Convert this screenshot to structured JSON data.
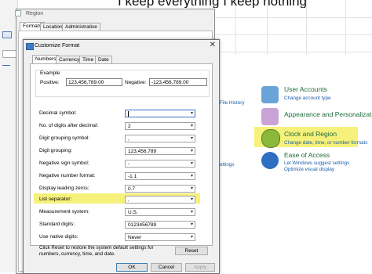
{
  "banner": {
    "text": "I keep everything I keep nothing"
  },
  "region": {
    "title": "Region",
    "tabs": [
      "Formats",
      "Location",
      "Administrative"
    ]
  },
  "customize": {
    "title": "Customize Format",
    "close": "✕",
    "tabs": [
      "Numbers",
      "Currency",
      "Time",
      "Date"
    ],
    "example": {
      "label": "Example",
      "positive_label": "Positive:",
      "positive_value": "123,456,789.00",
      "negative_label": "Negative:",
      "negative_value": "-123,456,789.00"
    },
    "rows": [
      {
        "label": "Decimal symbol:",
        "value": ""
      },
      {
        "label": "No. of digits after decimal:",
        "value": "2"
      },
      {
        "label": "Digit grouping symbol:",
        "value": ","
      },
      {
        "label": "Digit grouping:",
        "value": "123,456,789"
      },
      {
        "label": "Negative sign symbol:",
        "value": "-"
      },
      {
        "label": "Negative number format:",
        "value": "-1.1"
      },
      {
        "label": "Display leading zeros:",
        "value": "0.7"
      },
      {
        "label": "List separator:",
        "value": ","
      },
      {
        "label": "Measurement system:",
        "value": "U.S."
      },
      {
        "label": "Standard digits:",
        "value": "0123456789"
      },
      {
        "label": "Use native digits:",
        "value": "Never"
      }
    ],
    "reset_text": "Click Reset to restore the system default settings for numbers, currency, time, and date.",
    "reset_button": "Reset",
    "ok_button": "OK",
    "cancel_button": "Cancel",
    "apply_button": "Apply"
  },
  "control_panel": {
    "user_accounts": {
      "title": "User Accounts",
      "link": "Change account type"
    },
    "appearance": {
      "title": "Appearance and Personalization"
    },
    "clock": {
      "title": "Clock and Region",
      "link": "Change date, time, or number formats"
    },
    "ease": {
      "title": "Ease of Access",
      "link1": "Let Windows suggest settings",
      "link2": "Optimize visual display"
    },
    "file_history": "File History",
    "settings": "ettings"
  }
}
